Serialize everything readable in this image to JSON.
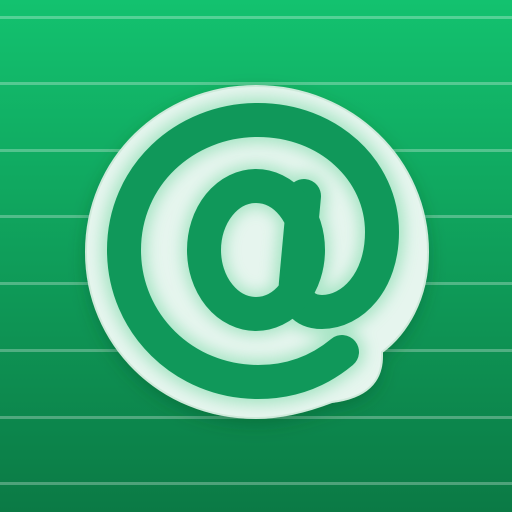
{
  "icon": {
    "symbol": "at-sign",
    "colors": {
      "background_top": "#13c26f",
      "background_bottom": "#0b7a45",
      "stripe": "#ffffff",
      "badge_fill": "#e6f5ee",
      "badge_edge": "#cfeadb",
      "glyph": "#10985a",
      "glyph_glow": "#9fe3bf"
    }
  }
}
